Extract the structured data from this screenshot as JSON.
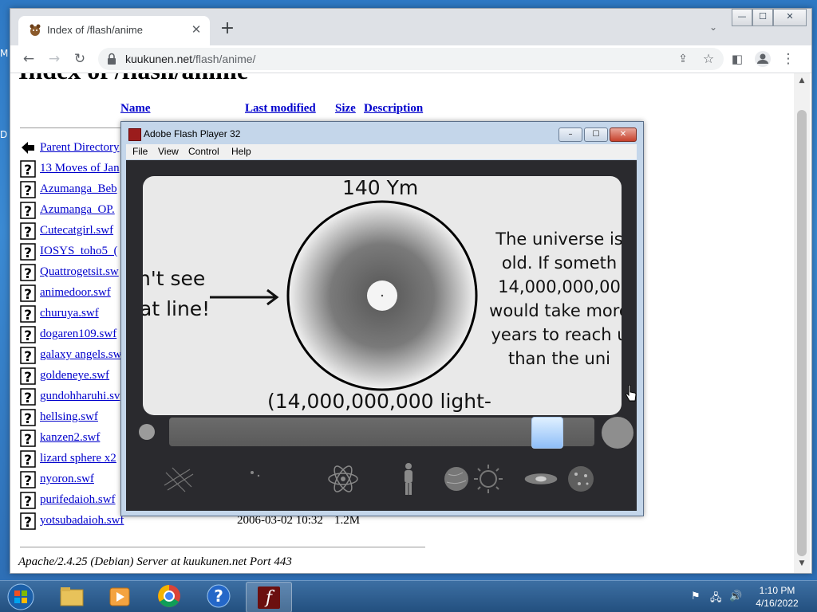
{
  "desktop": {
    "edge_labels": [
      "M",
      "D"
    ]
  },
  "browser": {
    "tab_title": "Index of /flash/anime",
    "url_host": "kuukunen.net",
    "url_path": "/flash/anime/",
    "window_controls": {
      "minimize": "—",
      "maximize": "☐",
      "close": "✕"
    }
  },
  "page": {
    "heading": "Index of /flash/anime",
    "columns": {
      "name": "Name",
      "last_modified": "Last modified",
      "size": "Size",
      "description": "Description"
    },
    "entries": [
      {
        "name": "Parent Directory",
        "icon": "back-icon"
      },
      {
        "name": "13 Moves of Jan",
        "icon": "unknown-file-icon"
      },
      {
        "name": "Azumanga_Beb",
        "icon": "unknown-file-icon"
      },
      {
        "name": "Azumanga_OP.",
        "icon": "unknown-file-icon"
      },
      {
        "name": "Cutecatgirl.swf",
        "icon": "unknown-file-icon"
      },
      {
        "name": "IOSYS_toho5_(",
        "icon": "unknown-file-icon"
      },
      {
        "name": "Quattrogetsit.sw",
        "icon": "unknown-file-icon"
      },
      {
        "name": "animedoor.swf",
        "icon": "unknown-file-icon"
      },
      {
        "name": "churuya.swf",
        "icon": "unknown-file-icon"
      },
      {
        "name": "dogaren109.swf",
        "icon": "unknown-file-icon"
      },
      {
        "name": "galaxy angels.sw",
        "icon": "unknown-file-icon"
      },
      {
        "name": "goldeneye.swf",
        "icon": "unknown-file-icon"
      },
      {
        "name": "gundohharuhi.sv",
        "icon": "unknown-file-icon"
      },
      {
        "name": "hellsing.swf",
        "icon": "unknown-file-icon"
      },
      {
        "name": "kanzen2.swf",
        "icon": "unknown-file-icon"
      },
      {
        "name": "lizard sphere x2",
        "icon": "unknown-file-icon"
      },
      {
        "name": "nyoron.swf",
        "icon": "unknown-file-icon"
      },
      {
        "name": "purifedaioh.swf",
        "icon": "unknown-file-icon"
      },
      {
        "name": "yotsubadaioh.swf",
        "icon": "unknown-file-icon",
        "modified": "2006-03-02 10:32",
        "size": "1.2M"
      }
    ],
    "server_signature": "Apache/2.4.25 (Debian) Server at kuukunen.net Port 443"
  },
  "flash": {
    "title": "Adobe Flash Player 32",
    "menu": [
      "File",
      "View",
      "Control",
      "Help"
    ],
    "scale_label": "140 Ym",
    "left_text": [
      "n't see",
      "at line!"
    ],
    "universe_text": [
      "The universe is",
      "old.  If someth",
      "14,000,000,00",
      "would take more",
      "years to reach u",
      "than the uni"
    ],
    "bottom_text": "(14,000,000,000 light-",
    "slider_value": 0.92,
    "scale_icons": [
      "string-grid-icon",
      "particle-icon",
      "atom-icon",
      "human-icon",
      "planet-icon",
      "sun-icon",
      "galaxy-icon",
      "cluster-icon"
    ]
  },
  "taskbar": {
    "apps": [
      "explorer",
      "media-player",
      "chrome",
      "help",
      "flash-player"
    ],
    "time": "1:10 PM",
    "date": "4/16/2022"
  },
  "colors": {
    "link": "#0000cc",
    "flash_title_bg": "#c4d6ea",
    "taskbar": "#2f5f92"
  }
}
